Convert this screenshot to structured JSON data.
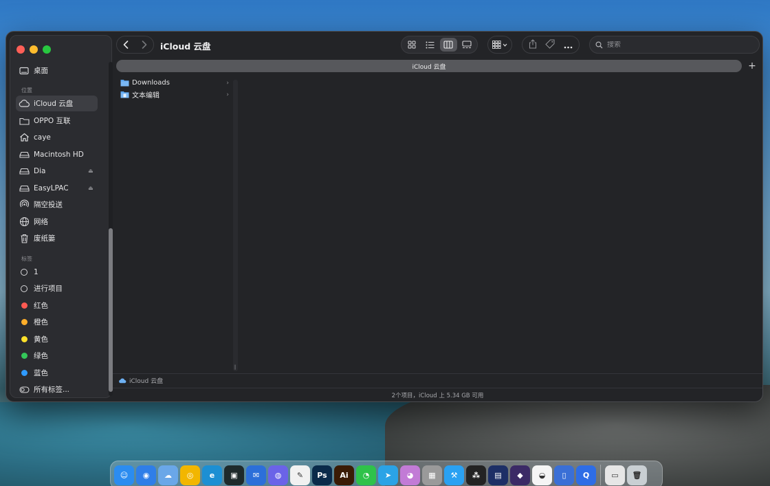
{
  "window": {
    "title": "iCloud 云盘",
    "path_tab": "iCloud 云盘",
    "add_tab_label": "+"
  },
  "sidebar": {
    "items_top": [
      {
        "label": "桌面",
        "icon": "desktop-icon"
      }
    ],
    "section_locations": "位置",
    "locations": [
      {
        "label": "iCloud 云盘",
        "icon": "icloud-icon",
        "active": true
      },
      {
        "label": "OPPO 互联",
        "icon": "folder-icon"
      },
      {
        "label": "caye",
        "icon": "home-icon"
      },
      {
        "label": "Macintosh HD",
        "icon": "disk-icon"
      },
      {
        "label": "Dia",
        "icon": "disk-icon",
        "eject": true
      },
      {
        "label": "EasyLPAC",
        "icon": "disk-icon",
        "eject": true
      },
      {
        "label": "隔空投送",
        "icon": "airdrop-icon"
      },
      {
        "label": "网络",
        "icon": "network-icon"
      },
      {
        "label": "废纸篓",
        "icon": "trash-icon"
      }
    ],
    "section_tags": "标签",
    "tags": [
      {
        "label": "1",
        "color": "ring"
      },
      {
        "label": "进行项目",
        "color": "ring"
      },
      {
        "label": "红色",
        "color": "#ff5a52"
      },
      {
        "label": "橙色",
        "color": "#ffae2a"
      },
      {
        "label": "黄色",
        "color": "#ffe12a"
      },
      {
        "label": "绿色",
        "color": "#34c759"
      },
      {
        "label": "蓝色",
        "color": "#2f9bff"
      },
      {
        "label": "所有标签...",
        "color": "all"
      }
    ]
  },
  "toolbar": {
    "search_placeholder": "搜索"
  },
  "files": [
    {
      "name": "Downloads"
    },
    {
      "name": "文本编辑"
    }
  ],
  "pathbar": {
    "label": "iCloud 云盘"
  },
  "status": {
    "text": "2个项目，iCloud 上 5.34 GB 可用"
  },
  "dock": {
    "apps": [
      {
        "name": "finder-icon",
        "color": "#2b8cf0",
        "glyph": "☺"
      },
      {
        "name": "safari-icon",
        "color": "#2f7ee8",
        "glyph": "◉"
      },
      {
        "name": "weather-icon",
        "color": "#6aa7e8",
        "glyph": "☁"
      },
      {
        "name": "chrome-icon",
        "color": "#f2b600",
        "glyph": "◎"
      },
      {
        "name": "edge-icon",
        "color": "#1c8fd3",
        "glyph": "e"
      },
      {
        "name": "terminal-icon",
        "color": "#1e2a2b",
        "glyph": "▣"
      },
      {
        "name": "mail-icon",
        "color": "#2c6fd9",
        "glyph": "✉"
      },
      {
        "name": "messenger-icon",
        "color": "#6b63e8",
        "glyph": "◍"
      },
      {
        "name": "pen-icon",
        "color": "#f1f1f1",
        "glyph": "✎"
      },
      {
        "name": "photoshop-icon",
        "color": "#0a2a4a",
        "glyph": "Ps"
      },
      {
        "name": "illustrator-icon",
        "color": "#3a1b05",
        "glyph": "Ai"
      },
      {
        "name": "wechat-icon",
        "color": "#2fc24a",
        "glyph": "◔"
      },
      {
        "name": "telegram-icon",
        "color": "#2ba3e6",
        "glyph": "➤"
      },
      {
        "name": "cat-app-icon",
        "color": "#c27bd6",
        "glyph": "◕"
      },
      {
        "name": "calculator-icon",
        "color": "#9a9a9a",
        "glyph": "▦"
      },
      {
        "name": "xcode-icon",
        "color": "#2aa1f2",
        "glyph": "⚒"
      },
      {
        "name": "launchpad-icon",
        "color": "#232323",
        "glyph": "⁂"
      },
      {
        "name": "finder-window-icon",
        "color": "#1d2f66",
        "glyph": "▤"
      },
      {
        "name": "obsidian-icon",
        "color": "#3b2a66",
        "glyph": "◆"
      },
      {
        "name": "qq-icon",
        "color": "#f5f5f5",
        "glyph": "◒"
      },
      {
        "name": "preview-icon",
        "color": "#3a6fd6",
        "glyph": "▯"
      },
      {
        "name": "q-app-icon",
        "color": "#2e6de6",
        "glyph": "Q"
      }
    ],
    "right_apps": [
      {
        "name": "archive-icon",
        "color": "#e6e6e6",
        "glyph": "▭"
      },
      {
        "name": "trash-dock-icon",
        "color": "#c9cfd3",
        "glyph": "🗑"
      }
    ]
  }
}
